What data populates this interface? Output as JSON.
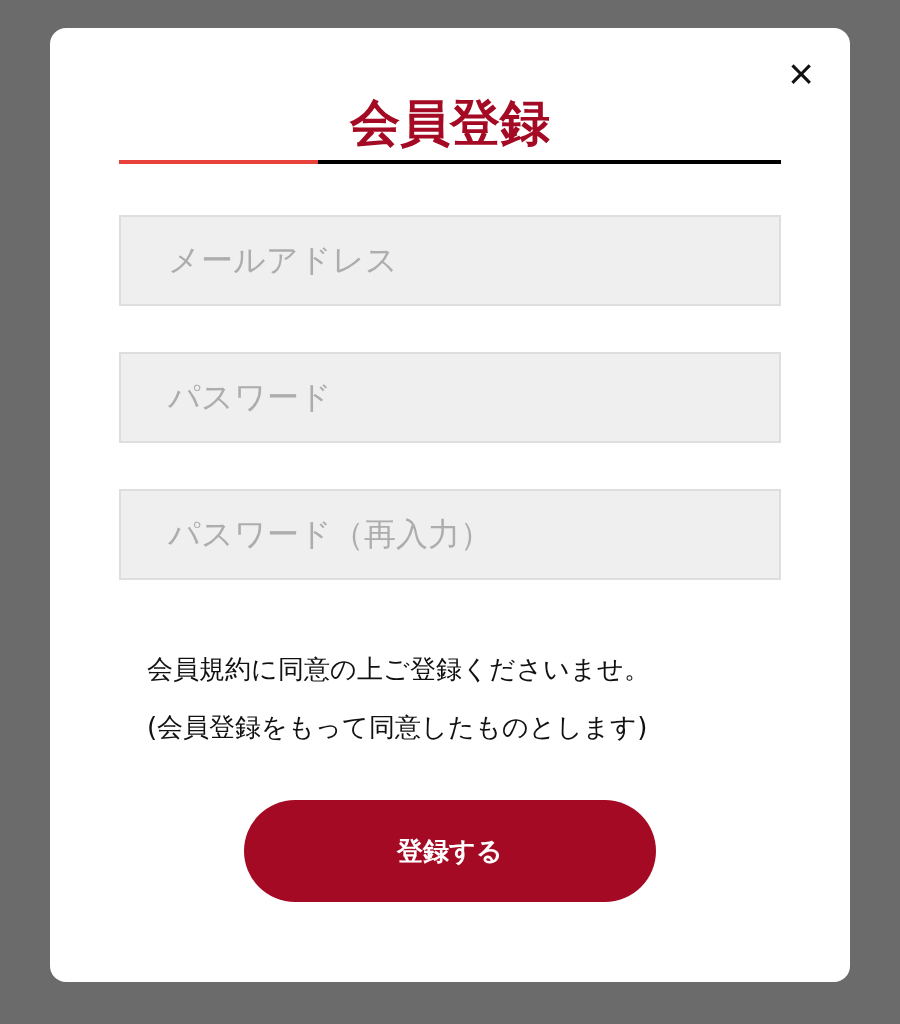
{
  "dialog": {
    "close": "×",
    "title": "会員登録",
    "fields": [
      {
        "placeholder": "メールアドレス"
      },
      {
        "placeholder": "パスワード"
      },
      {
        "placeholder": "パスワード（再入力）"
      }
    ],
    "notice": [
      "会員規約に同意の上ご登録くださいませ。",
      "(会員登録をもって同意したものとします)"
    ],
    "submit": "登録する"
  }
}
